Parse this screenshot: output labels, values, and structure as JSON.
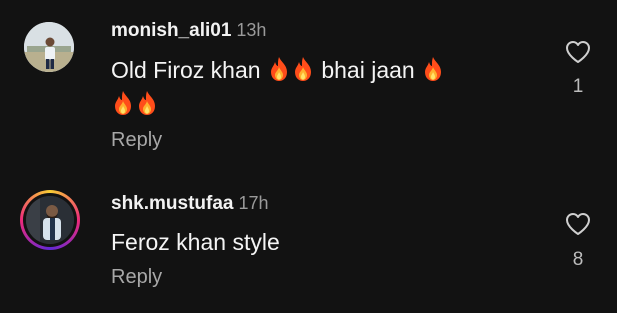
{
  "comments": [
    {
      "username": "monish_ali01",
      "time": "13h",
      "text_line1": "Old Firoz khan ",
      "text_mid": " bhai jaan ",
      "reply_label": "Reply",
      "like_count": "1"
    },
    {
      "username": "shk.mustufaa",
      "time": "17h",
      "text": "Feroz khan style",
      "reply_label": "Reply",
      "like_count": "8"
    }
  ],
  "colors": {
    "background": "#121212",
    "text": "#f2f2f2",
    "muted": "#9a9a9a",
    "story_ring": [
      "#f9ce34",
      "#ee2a7b",
      "#6228d7"
    ]
  },
  "icons": {
    "like": "heart-outline-icon",
    "emoji": "fire-emoji"
  }
}
